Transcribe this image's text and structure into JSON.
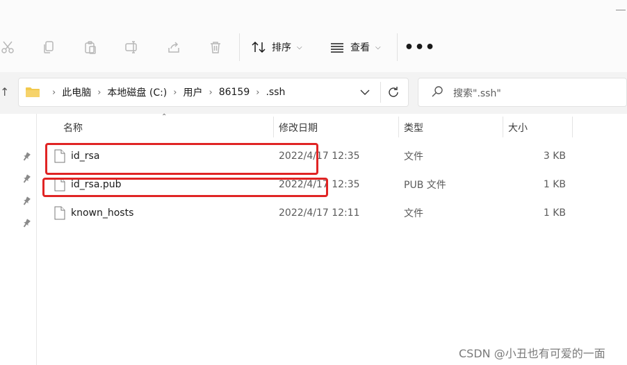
{
  "toolbar": {
    "icons": [
      "cut-icon",
      "copy-icon",
      "paste-icon",
      "rename-icon",
      "share-icon",
      "delete-icon"
    ],
    "sort_label": "排序",
    "view_label": "查看",
    "more_label": "•••"
  },
  "address": {
    "breadcrumbs": [
      "此电脑",
      "本地磁盘 (C:)",
      "用户",
      "86159",
      ".ssh"
    ]
  },
  "search": {
    "placeholder": "搜索\".ssh\""
  },
  "columns": {
    "name": "名称",
    "modified": "修改日期",
    "type": "类型",
    "size": "大小"
  },
  "files": [
    {
      "name": "id_rsa",
      "modified": "2022/4/17 12:35",
      "type": "文件",
      "size": "3 KB"
    },
    {
      "name": "id_rsa.pub",
      "modified": "2022/4/17 12:35",
      "type": "PUB 文件",
      "size": "1 KB"
    },
    {
      "name": "known_hosts",
      "modified": "2022/4/17 12:11",
      "type": "文件",
      "size": "1 KB"
    }
  ],
  "watermark": "CSDN @小丑也有可爱的一面",
  "colors": {
    "highlight": "#e02424",
    "folder": "#f2c94c",
    "toolbar_bg": "#fbfbfb",
    "nav_bg": "#f3f3f3"
  }
}
